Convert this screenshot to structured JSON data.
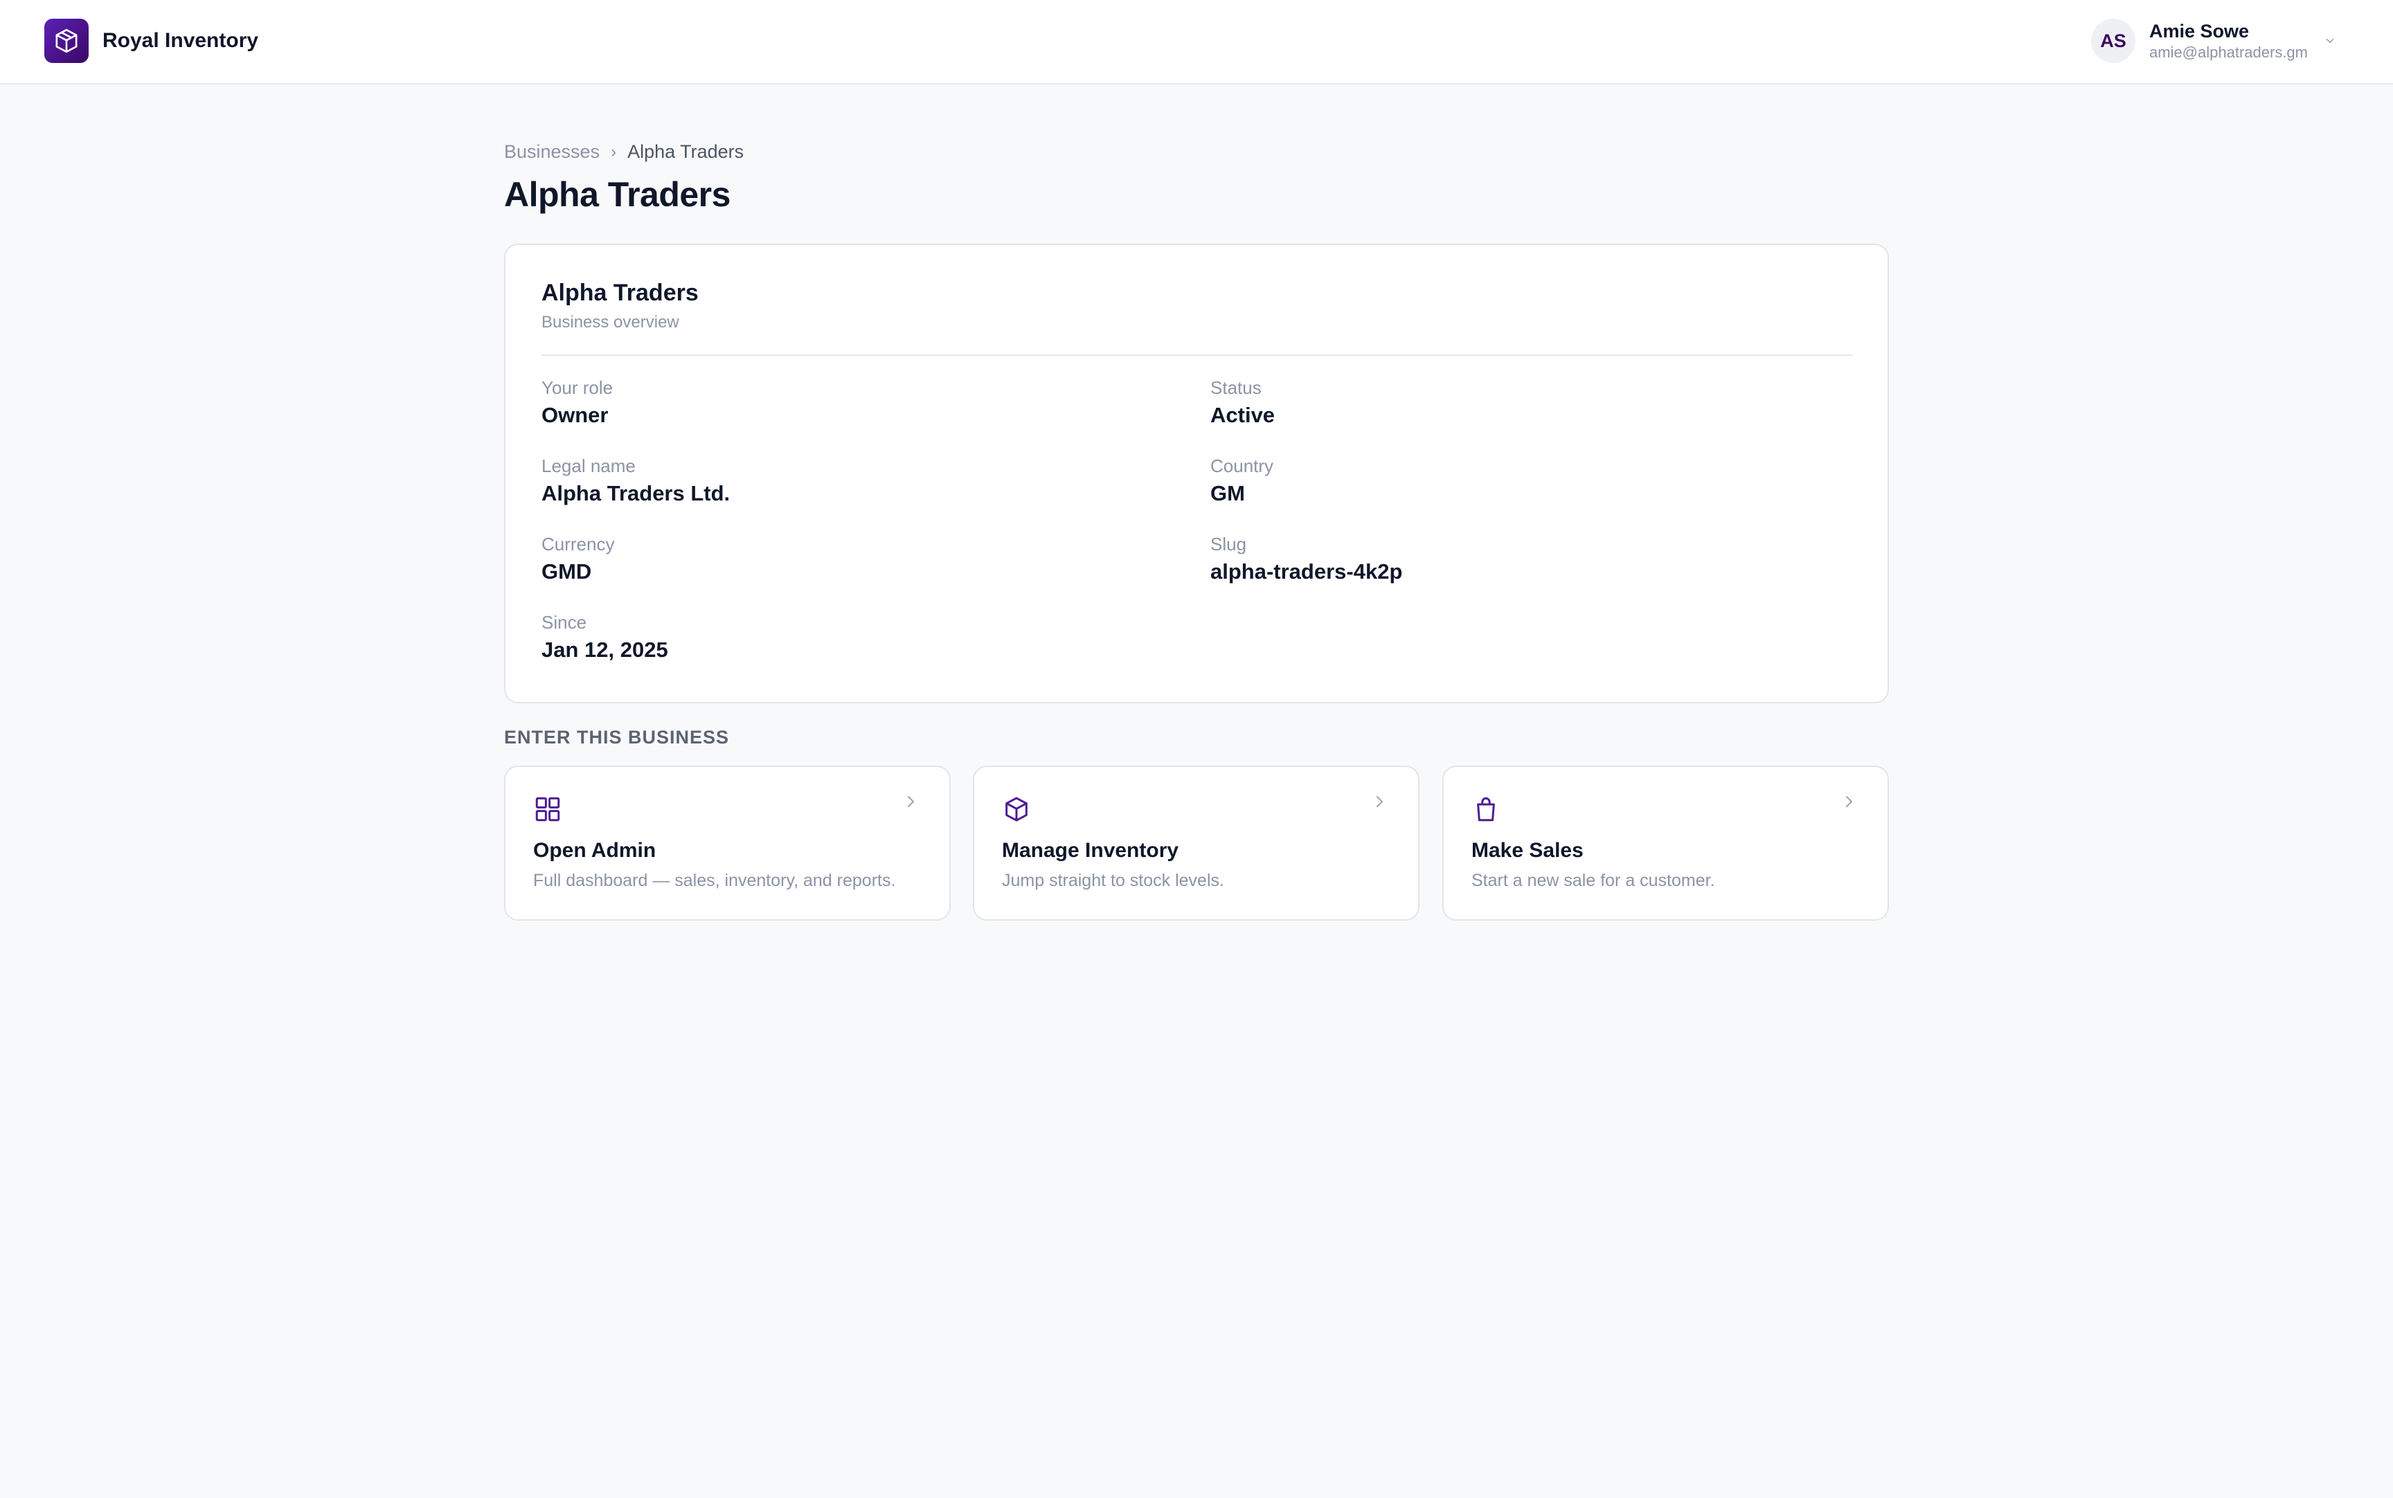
{
  "app": {
    "name": "Royal Inventory",
    "brand_color": "#4c1d95"
  },
  "user": {
    "initials": "AS",
    "name": "Amie Sowe",
    "email": "amie@alphatraders.gm"
  },
  "breadcrumb": {
    "parent": "Businesses",
    "separator": "›",
    "current": "Alpha Traders"
  },
  "page": {
    "title": "Alpha Traders"
  },
  "overview": {
    "title": "Alpha Traders",
    "subtitle": "Business overview",
    "fields": [
      {
        "label": "Your role",
        "value": "Owner"
      },
      {
        "label": "Status",
        "value": "Active"
      },
      {
        "label": "Legal name",
        "value": "Alpha Traders Ltd."
      },
      {
        "label": "Country",
        "value": "GM"
      },
      {
        "label": "Currency",
        "value": "GMD"
      },
      {
        "label": "Slug",
        "value": "alpha-traders-4k2p"
      },
      {
        "label": "Since",
        "value": "Jan 12, 2025"
      }
    ]
  },
  "enter_section": {
    "label": "ENTER THIS BUSINESS",
    "actions": [
      {
        "icon": "grid-icon",
        "title": "Open Admin",
        "description": "Full dashboard — sales, inventory, and reports."
      },
      {
        "icon": "box-icon",
        "title": "Manage Inventory",
        "description": "Jump straight to stock levels."
      },
      {
        "icon": "shopping-bag-icon",
        "title": "Make Sales",
        "description": "Start a new sale for a customer."
      }
    ]
  }
}
